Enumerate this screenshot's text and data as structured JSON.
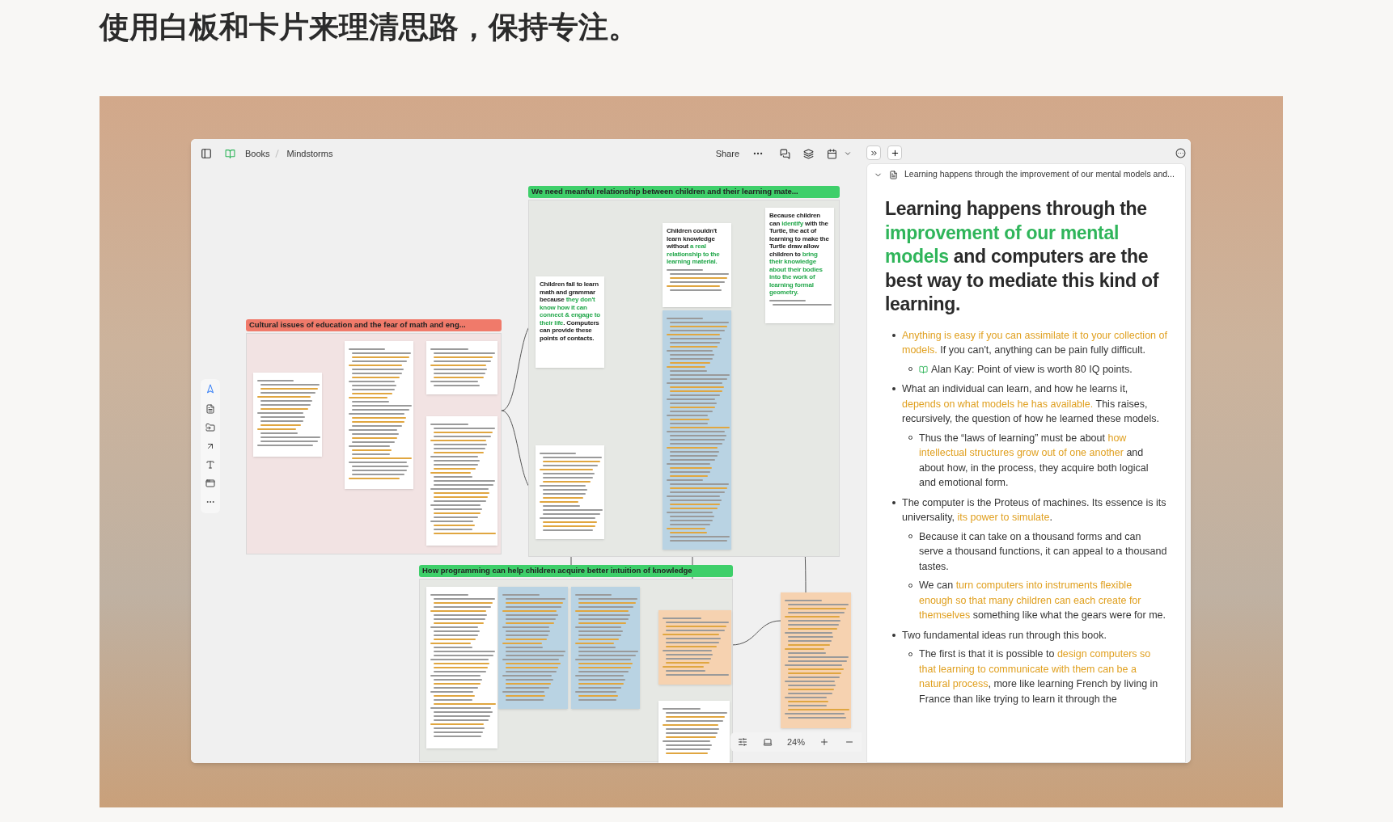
{
  "headline": "使用白板和卡片来理清思路，保持专注。",
  "toolbar": {
    "breadcrumbs": [
      "Books",
      "Mindstorms"
    ],
    "share": "Share"
  },
  "canvas": {
    "groups": [
      {
        "title": "Cultural issues of education and the fear of math and eng...",
        "color": "#f07a6a"
      },
      {
        "title": "We need meanful relationship between children and their learning mate...",
        "color": "#3ecf6a"
      },
      {
        "title": "How programming can help children acquire better intuition of knowledge",
        "color": "#3ecf6a"
      }
    ],
    "cards": [
      {
        "kind": "white"
      },
      {
        "kind": "white"
      },
      {
        "kind": "white"
      },
      {
        "kind": "white"
      },
      {
        "kind": "white",
        "heading": [
          {
            "text": "Children fail to learn math and grammar because ",
            "highlight": false
          },
          {
            "text": "they don't know how it can connect & engage to their life",
            "highlight": true
          },
          {
            "text": ". Computers can provide these points of contacts.",
            "highlight": false
          }
        ]
      },
      {
        "kind": "white",
        "heading": [
          {
            "text": "Children couldn't learn knowledge without ",
            "highlight": false
          },
          {
            "text": "a real relationship to the learning material.",
            "highlight": true
          }
        ]
      },
      {
        "kind": "white",
        "heading": [
          {
            "text": "Because children can ",
            "highlight": false
          },
          {
            "text": "identify",
            "highlight": true
          },
          {
            "text": " with the Turtle, the act of learning to make the Turtle draw allow children to ",
            "highlight": false
          },
          {
            "text": "bring their knowledge about their bodies into the work of learning formal geometry.",
            "highlight": true
          }
        ]
      },
      {
        "kind": "blue"
      },
      {
        "kind": "white"
      },
      {
        "kind": "white"
      },
      {
        "kind": "blue"
      },
      {
        "kind": "blue"
      },
      {
        "kind": "orange"
      },
      {
        "kind": "orange"
      },
      {
        "kind": "white"
      }
    ],
    "zoom": "24%"
  },
  "document": {
    "breadcrumb": "Learning happens through the improvement of our mental models and...",
    "title": [
      {
        "text": "Learning happens through the ",
        "highlight": false
      },
      {
        "text": "improvement of our mental models",
        "highlight": true
      },
      {
        "text": " and computers are the best way to mediate this kind of learning.",
        "highlight": false
      }
    ],
    "items": [
      {
        "segments": [
          {
            "text": "Anything is easy if you can assimilate it to your collection of models.",
            "highlight": true
          },
          {
            "text": " If you can't, anything can be pain fully difficult.",
            "highlight": false
          }
        ],
        "children": [
          {
            "kind": "reference",
            "segments": [
              {
                "text": "Alan Kay: Point of view is worth 80 IQ points.",
                "highlight": false
              }
            ]
          }
        ]
      },
      {
        "segments": [
          {
            "text": "What an individual can learn, and how he learns it, ",
            "highlight": false
          },
          {
            "text": "depends on what models he has available.",
            "highlight": true
          },
          {
            "text": " This raises, recursively, the question of how he learned these models.",
            "highlight": false
          }
        ],
        "children": [
          {
            "kind": "note",
            "segments": [
              {
                "text": "Thus the “laws of learning” must be about ",
                "highlight": false
              },
              {
                "text": "how intellectual structures grow out of one another",
                "highlight": true
              },
              {
                "text": " and about how, in the process, they acquire both logical and emotional form.",
                "highlight": false
              }
            ]
          }
        ]
      },
      {
        "segments": [
          {
            "text": "The computer is the Proteus of machines. Its essence is its universality, ",
            "highlight": false
          },
          {
            "text": "its power to simulate",
            "highlight": true
          },
          {
            "text": ".",
            "highlight": false
          }
        ],
        "children": [
          {
            "kind": "note",
            "segments": [
              {
                "text": "Because it can take on a thousand forms and can serve a thousand functions, it can appeal to a thousand tastes.",
                "highlight": false
              }
            ]
          },
          {
            "kind": "note",
            "segments": [
              {
                "text": "We can ",
                "highlight": false
              },
              {
                "text": "turn computers into instruments flexible enough so that many children can each create for themselves",
                "highlight": true
              },
              {
                "text": " something like what the gears were for me.",
                "highlight": false
              }
            ]
          }
        ]
      },
      {
        "segments": [
          {
            "text": "Two fundamental ideas run through this book.",
            "highlight": false
          }
        ],
        "children": [
          {
            "kind": "note",
            "segments": [
              {
                "text": "The first is that it is possible to ",
                "highlight": false
              },
              {
                "text": "design computers so that learning to communicate with them can be a natural process",
                "highlight": true
              },
              {
                "text": ", more like learning French by living in France than like trying to learn it through the",
                "highlight": false
              }
            ]
          }
        ]
      }
    ]
  }
}
